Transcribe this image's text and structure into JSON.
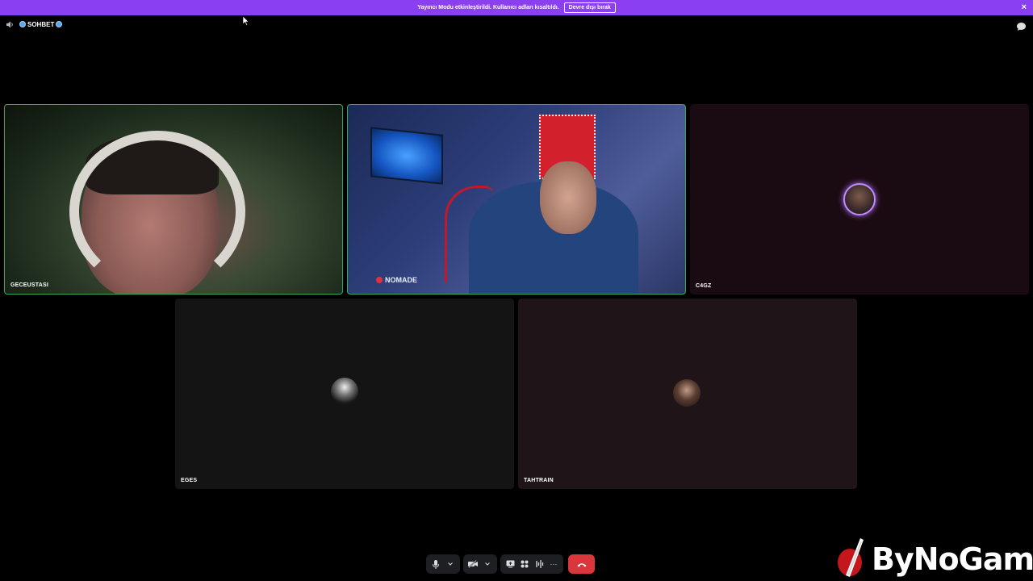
{
  "banner": {
    "text": "Yayıncı Modu etkinleştirildi. Kullanıcı adları kısaltıldı.",
    "button_label": "Devre dışı bırak",
    "close_icon": "×"
  },
  "channel": {
    "name": "SOHBET",
    "speaker_icon": "speaker-icon",
    "globe_icon": "globe-emoji"
  },
  "participants": [
    {
      "name": "GECEUSTASI",
      "type": "video",
      "speaking": true
    },
    {
      "name": "",
      "type": "video",
      "speaking": true,
      "overlay_text": "NOMADE"
    },
    {
      "name": "C4GZ",
      "type": "avatar",
      "speaking": true
    },
    {
      "name": "EGES",
      "type": "avatar",
      "speaking": false
    },
    {
      "name": "TAHTRAIN",
      "type": "avatar",
      "speaking": false
    }
  ],
  "controls": {
    "icons": [
      "microphone-icon",
      "chevron-down-icon",
      "camera-off-icon",
      "chevron-down-icon",
      "screen-share-icon",
      "activities-icon",
      "soundboard-icon",
      "more-icon",
      "hang-up-icon"
    ],
    "more_label": "···"
  },
  "watermark": {
    "text": "ByNoGame"
  },
  "colors": {
    "banner": "#8a3ff0",
    "speaking_border": "#3ba55d",
    "hangup": "#da373c"
  }
}
